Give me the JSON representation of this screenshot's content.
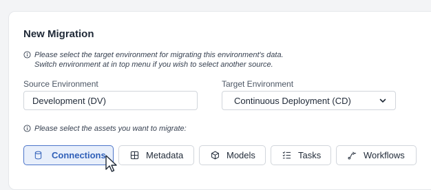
{
  "form": {
    "title": "New Migration",
    "info_line1": "Please select the target environment for migrating this environment's data.",
    "info_line2": "Switch environment at in top menu if you wish to select another source.",
    "source_label": "Source Environment",
    "source_value": "Development (DV)",
    "target_label": "Target Environment",
    "target_value": "Continuous Deployment (CD)",
    "assets_info": "Please select the assets you want to migrate:"
  },
  "assets": [
    {
      "label": "Connections",
      "icon": "database-icon",
      "selected": true
    },
    {
      "label": "Metadata",
      "icon": "table-icon",
      "selected": false
    },
    {
      "label": "Models",
      "icon": "cube-icon",
      "selected": false
    },
    {
      "label": "Tasks",
      "icon": "checklist-icon",
      "selected": false
    },
    {
      "label": "Workflows",
      "icon": "workflow-icon",
      "selected": false
    }
  ],
  "colors": {
    "accent": "#2f5fb8",
    "selected_bg": "#e8effb",
    "border": "#d1d5db"
  }
}
